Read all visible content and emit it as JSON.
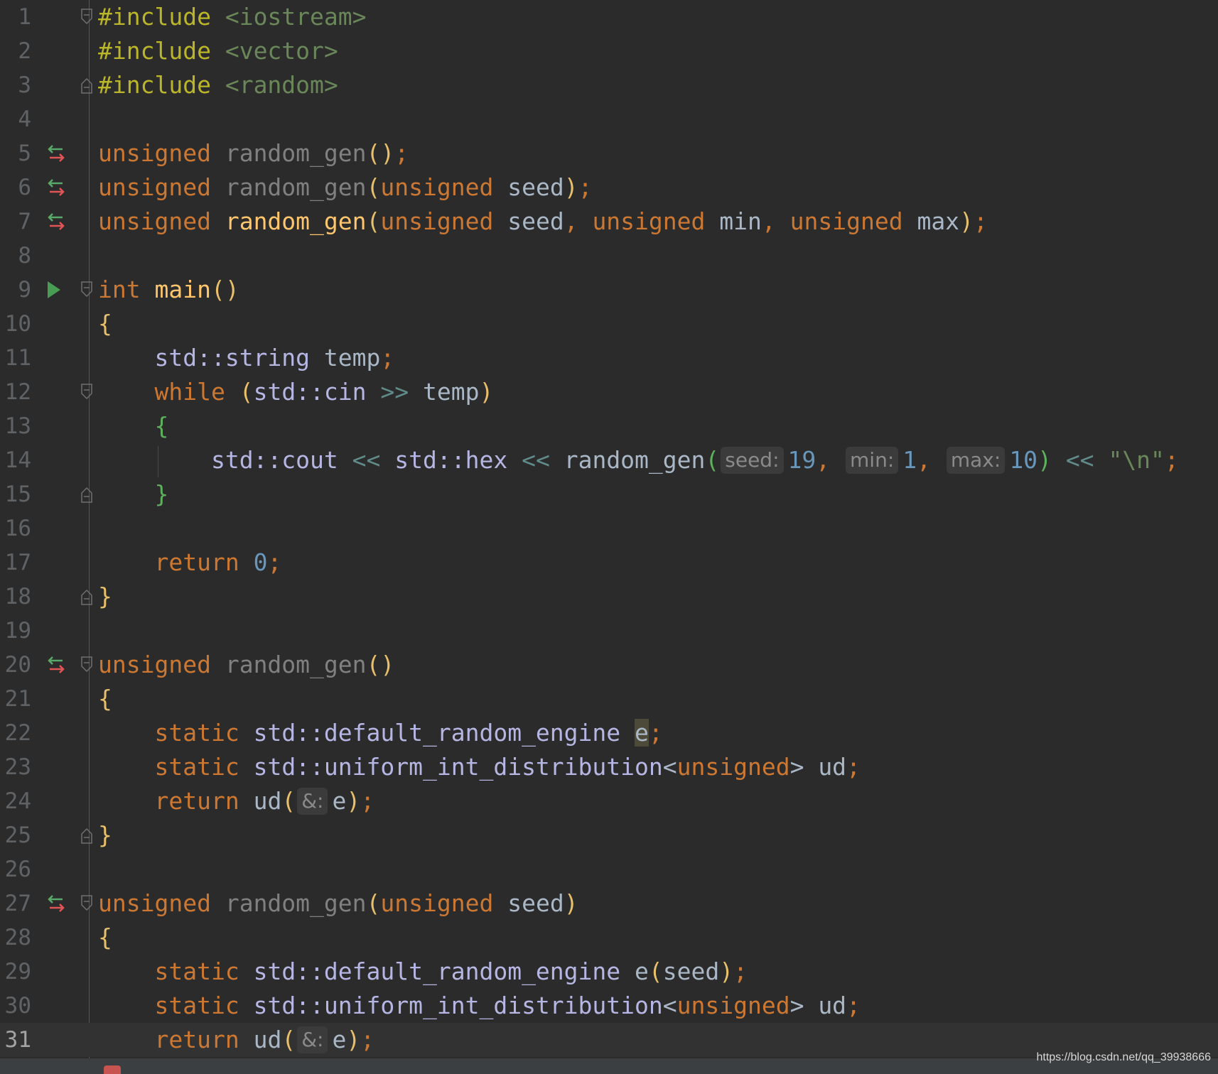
{
  "editor": {
    "language": "C++",
    "current_line": 31,
    "lines": [
      {
        "n": "1",
        "text": "#include <iostream>"
      },
      {
        "n": "2",
        "text": "#include <vector>"
      },
      {
        "n": "3",
        "text": "#include <random>"
      },
      {
        "n": "4",
        "text": ""
      },
      {
        "n": "5",
        "text": "unsigned random_gen();"
      },
      {
        "n": "6",
        "text": "unsigned random_gen(unsigned seed);"
      },
      {
        "n": "7",
        "text": "unsigned random_gen(unsigned seed, unsigned min, unsigned max);"
      },
      {
        "n": "8",
        "text": ""
      },
      {
        "n": "9",
        "text": "int main()"
      },
      {
        "n": "10",
        "text": "{"
      },
      {
        "n": "11",
        "text": "    std::string temp;"
      },
      {
        "n": "12",
        "text": "    while (std::cin >> temp)"
      },
      {
        "n": "13",
        "text": "    {"
      },
      {
        "n": "14",
        "text": "        std::cout << std::hex << random_gen(seed: 19, min: 1, max: 10) << \"\\n\";"
      },
      {
        "n": "15",
        "text": "    }"
      },
      {
        "n": "16",
        "text": ""
      },
      {
        "n": "17",
        "text": "    return 0;"
      },
      {
        "n": "18",
        "text": "}"
      },
      {
        "n": "19",
        "text": ""
      },
      {
        "n": "20",
        "text": "unsigned random_gen()"
      },
      {
        "n": "21",
        "text": "{"
      },
      {
        "n": "22",
        "text": "    static std::default_random_engine e;"
      },
      {
        "n": "23",
        "text": "    static std::uniform_int_distribution<unsigned> ud;"
      },
      {
        "n": "24",
        "text": "    return ud(&: e);"
      },
      {
        "n": "25",
        "text": "}"
      },
      {
        "n": "26",
        "text": ""
      },
      {
        "n": "27",
        "text": "unsigned random_gen(unsigned seed)"
      },
      {
        "n": "28",
        "text": "{"
      },
      {
        "n": "29",
        "text": "    static std::default_random_engine e(seed);"
      },
      {
        "n": "30",
        "text": "    static std::uniform_int_distribution<unsigned> ud;"
      },
      {
        "n": "31",
        "text": "    return ud(&: e);"
      }
    ],
    "gutter_icons": {
      "5": "implementation-navigate-icon",
      "6": "implementation-navigate-icon",
      "7": "implementation-navigate-icon",
      "9": "run-icon",
      "20": "implementation-navigate-icon",
      "27": "implementation-navigate-icon"
    },
    "colors": {
      "background": "#2b2b2b",
      "keyword": "#cc7832",
      "preprocessor": "#bbb529",
      "string": "#6a8759",
      "number": "#6897bb",
      "function_declaration": "#ffc66d",
      "unused": "#808080",
      "class": "#b5b6e3",
      "default_text": "#a9b7c6"
    }
  },
  "watermark": "https://blog.csdn.net/qq_39938666"
}
